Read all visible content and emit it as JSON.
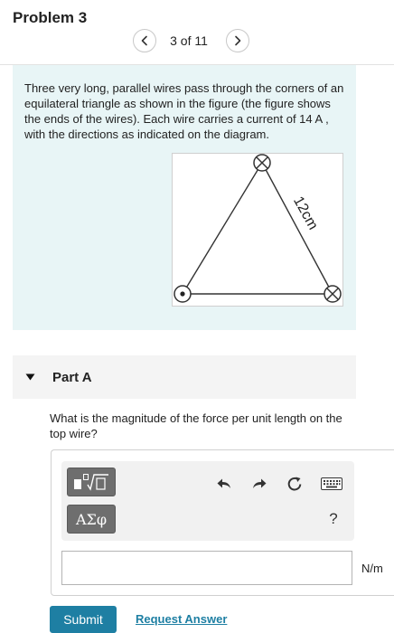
{
  "header": {
    "problem_title": "Problem 3",
    "counter": "3 of 11",
    "prev_icon": "chevron-left-icon",
    "next_icon": "chevron-right-icon"
  },
  "problem": {
    "text": "Three very long, parallel wires pass through the corners of an equilateral triangle as shown in the figure (the figure shows the ends of the wires). Each wire carries a current of 14 A , with the directions as indicated on the diagram.",
    "figure": {
      "side_label": "12cm",
      "top_wire": "current-into-page",
      "bottom_left_wire": "current-out-of-page",
      "bottom_right_wire": "current-into-page"
    }
  },
  "part_a": {
    "label": "Part A",
    "question": "What is the magnitude of the force per unit length on the top wire?",
    "toolbar": {
      "templates_icon": "templates-icon",
      "greek_label": "ΑΣφ",
      "undo_icon": "undo-icon",
      "redo_icon": "redo-icon",
      "reset_icon": "reset-icon",
      "keyboard_icon": "keyboard-icon",
      "help_label": "?"
    },
    "answer": {
      "value": "",
      "units": "N/m"
    },
    "submit_label": "Submit",
    "request_answer_label": "Request Answer"
  },
  "colors": {
    "problem_background": "#e8f5f6",
    "accent": "#1e7fa3",
    "toolbar_button": "#6e6e6e"
  }
}
